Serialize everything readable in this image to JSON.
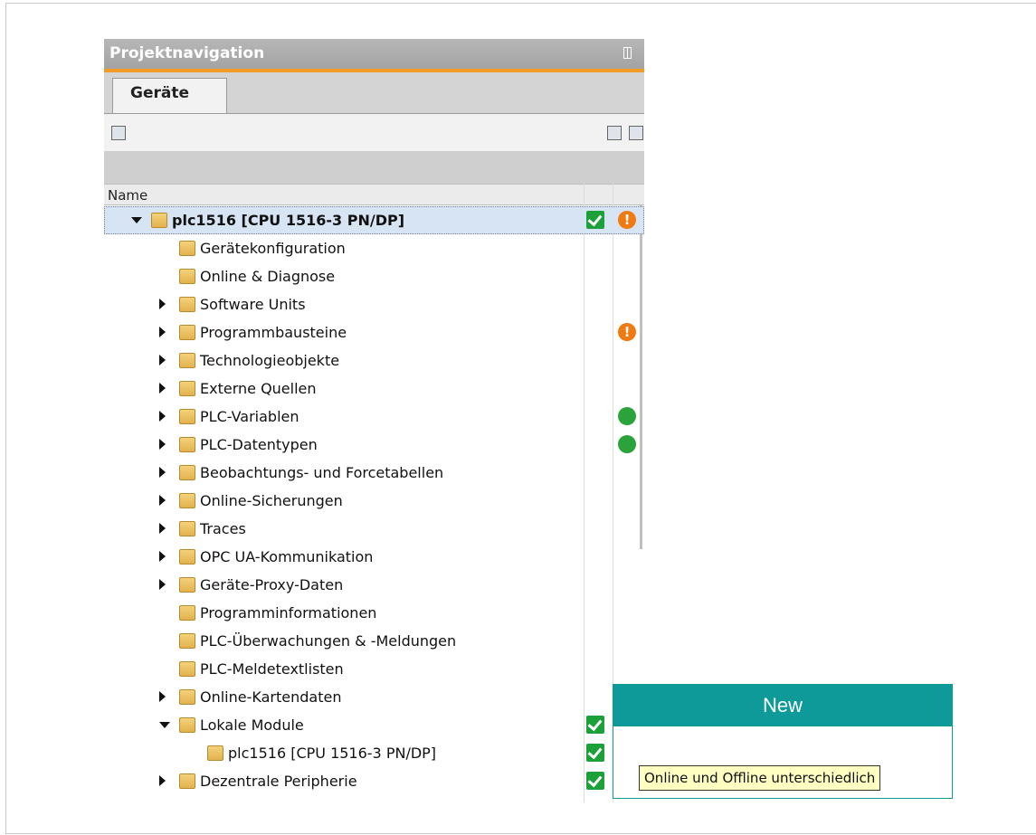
{
  "panel": {
    "title": "Projektnavigation"
  },
  "tabs": [
    {
      "label": "Geräte"
    }
  ],
  "table": {
    "column_name": "Name"
  },
  "tree": [
    {
      "label": "plc1516 [CPU 1516-3 PN/DP]",
      "expand": "down",
      "check": true,
      "status": "warning",
      "selected": true,
      "bold": true
    },
    {
      "label": "Gerätekonfiguration"
    },
    {
      "label": "Online & Diagnose"
    },
    {
      "label": "Software Units",
      "expand": "right"
    },
    {
      "label": "Programmbausteine",
      "expand": "right",
      "status": "warning"
    },
    {
      "label": "Technologieobjekte",
      "expand": "right"
    },
    {
      "label": "Externe Quellen",
      "expand": "right"
    },
    {
      "label": "PLC-Variablen",
      "expand": "right",
      "status": "ok"
    },
    {
      "label": "PLC-Datentypen",
      "expand": "right",
      "status": "ok"
    },
    {
      "label": "Beobachtungs- und Forcetabellen",
      "expand": "right"
    },
    {
      "label": "Online-Sicherungen",
      "expand": "right"
    },
    {
      "label": "Traces",
      "expand": "right"
    },
    {
      "label": "OPC UA-Kommunikation",
      "expand": "right"
    },
    {
      "label": "Geräte-Proxy-Daten",
      "expand": "right"
    },
    {
      "label": "Programminformationen"
    },
    {
      "label": "PLC-Überwachungen & -Meldungen"
    },
    {
      "label": "PLC-Meldetextlisten"
    },
    {
      "label": "Online-Kartendaten",
      "expand": "right"
    },
    {
      "label": "Lokale Module",
      "expand": "down",
      "check": true,
      "status": "warning"
    },
    {
      "label": "plc1516 [CPU 1516-3 PN/DP]",
      "check": true,
      "status": "different"
    },
    {
      "label": "Dezentrale Peripherie",
      "expand": "right",
      "check": true
    }
  ],
  "callout": {
    "title": "New"
  },
  "tooltip": {
    "text": "Online und Offline unterschiedlich"
  },
  "colors": {
    "accent": "#f29c28",
    "teal": "#0f9a9a",
    "ok": "#2aa33b",
    "warning": "#ee7a11"
  }
}
